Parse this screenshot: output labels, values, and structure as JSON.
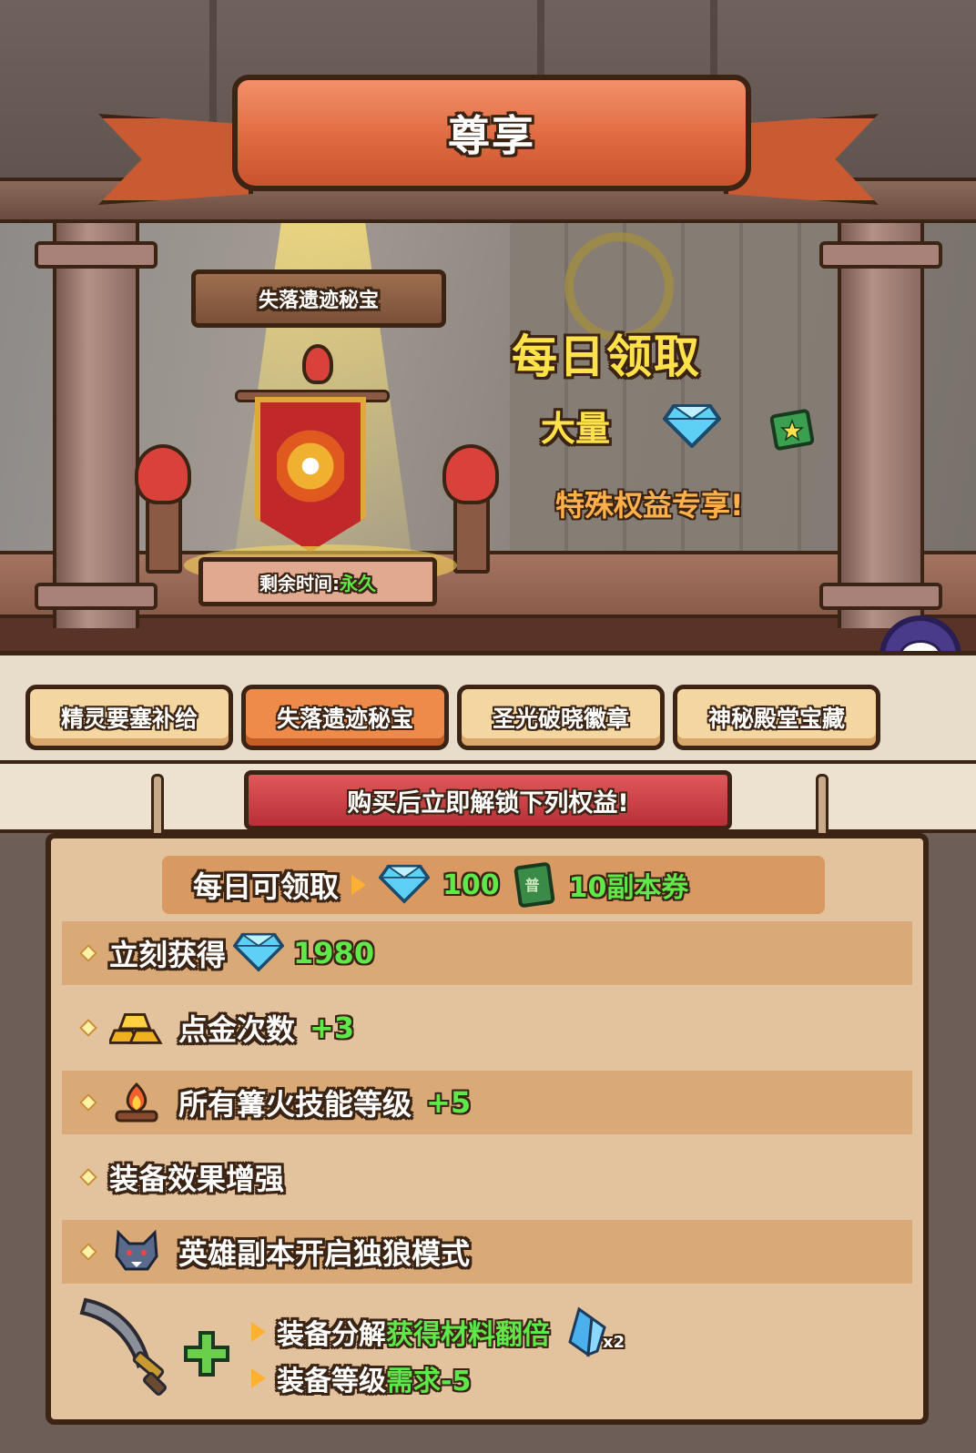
{
  "header": {
    "title": "尊享"
  },
  "showcase": {
    "pack_name": "失落遗迹秘宝",
    "remaining_label": "剩余时间:",
    "remaining_value": "永久",
    "promo_title": "每日领取",
    "promo_bulk": "大量",
    "promo_perk": "特殊权益专享!"
  },
  "tabs": [
    {
      "label": "精灵要塞补给",
      "active": false
    },
    {
      "label": "失落遗迹秘宝",
      "active": true
    },
    {
      "label": "圣光破晓徽章",
      "active": false
    },
    {
      "label": "神秘殿堂宝藏",
      "active": false
    }
  ],
  "benefits_banner": "购买后立即解锁下列权益!",
  "daily": {
    "label": "每日可领取",
    "gems": "100",
    "ticket_icon_text": "普",
    "tickets": "10副本券"
  },
  "rows": [
    {
      "label": "立刻获得",
      "value": "1980",
      "icon": "diamond-icon"
    },
    {
      "label": "点金次数",
      "value": "+3",
      "icon": "gold-bars-icon"
    },
    {
      "label": "所有篝火技能等级",
      "value": "+5",
      "icon": "campfire-icon"
    },
    {
      "label": "装备效果增强",
      "value": "",
      "icon": ""
    },
    {
      "label": "英雄副本开启独狼模式",
      "value": "",
      "icon": "wolf-icon"
    }
  ],
  "equipment": {
    "line1_prefix": "装备分解",
    "line1_highlight": "获得材料翻倍",
    "crystal_multiplier": "x2",
    "line2_prefix": "装备等级",
    "line2_highlight": "需求-5"
  },
  "colors": {
    "accent_orange": "#e06a40",
    "highlight_green": "#5ee84a",
    "highlight_yellow": "#ffe14a",
    "outline": "#3b2414"
  }
}
